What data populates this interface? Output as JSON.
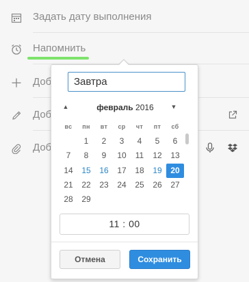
{
  "rows": {
    "due_date": {
      "label": "Задать дату выполнения",
      "icon": "calendar-icon"
    },
    "remind": {
      "label": "Напомнить",
      "icon": "alarm-clock-icon"
    },
    "add1": {
      "label": "Доб",
      "icon": "plus-icon"
    },
    "add2": {
      "label": "Доб",
      "icon": "pencil-icon"
    },
    "add3": {
      "label": "Доб",
      "icon": "paperclip-icon"
    }
  },
  "right_icons": [
    "external-link-icon",
    "microphone-icon",
    "dropbox-icon"
  ],
  "reminder_popup": {
    "date_input_value": "Завтра",
    "month_label": "февраль",
    "year_label": "2016",
    "weekdays": [
      "вс",
      "пн",
      "вт",
      "ср",
      "чт",
      "пт",
      "сб"
    ],
    "weeks": [
      [
        "",
        "1",
        "2",
        "3",
        "4",
        "5",
        "6"
      ],
      [
        "7",
        "8",
        "9",
        "10",
        "11",
        "12",
        "13"
      ],
      [
        "14",
        "15",
        "16",
        "17",
        "18",
        "19",
        "20"
      ],
      [
        "21",
        "22",
        "23",
        "24",
        "25",
        "26",
        "27"
      ],
      [
        "28",
        "29",
        "",
        "",
        "",
        "",
        ""
      ]
    ],
    "highlighted_days": [
      "15",
      "16",
      "19"
    ],
    "selected_day": "20",
    "time_hour": "11",
    "time_separator": ":",
    "time_minute": "00",
    "cancel_label": "Отмена",
    "save_label": "Сохранить"
  },
  "colors": {
    "accent": "#2f8de0",
    "highlight_underline": "#7ee36b",
    "link_day": "#2a86c5"
  }
}
